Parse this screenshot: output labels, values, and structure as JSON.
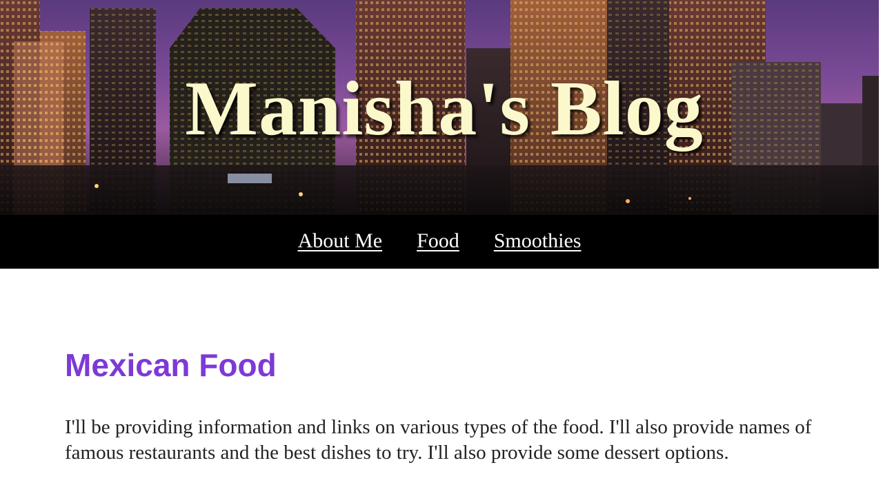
{
  "header": {
    "site_title": "Manisha's Blog"
  },
  "nav": {
    "items": [
      {
        "label": "About Me"
      },
      {
        "label": "Food"
      },
      {
        "label": "Smoothies"
      }
    ]
  },
  "main": {
    "heading": "Mexican Food",
    "intro": "I'll be providing information and links on various types of the food. I'll also provide names of famous restaurants and the best dishes to try. I'll also provide some dessert options."
  },
  "colors": {
    "title_text": "#fbf8cc",
    "nav_background": "#000000",
    "nav_link": "#ffffff",
    "heading": "#7d3ad6",
    "body_text": "#222222"
  }
}
